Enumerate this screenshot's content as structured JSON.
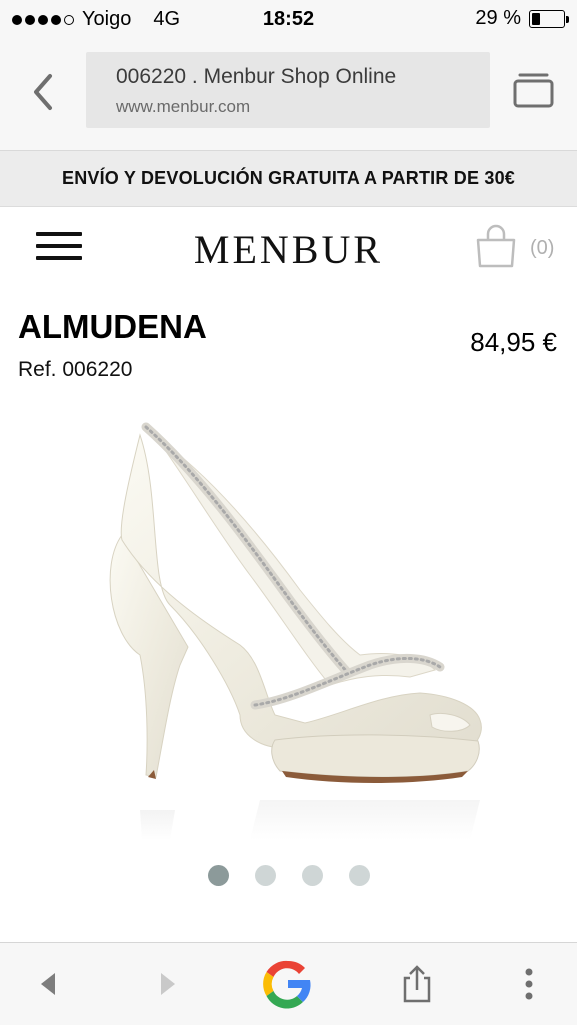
{
  "status": {
    "carrier": "Yoigo",
    "network": "4G",
    "time": "18:52",
    "battery_text": "29 %",
    "battery_level": 0.29
  },
  "browser": {
    "page_title": "006220 . Menbur Shop Online",
    "host": "www.menbur.com",
    "back_icon": "chevron-left-icon",
    "tabs_icon": "tabs-icon"
  },
  "promo": {
    "text": "ENVÍO Y DEVOLUCIÓN GRATUITA A PARTIR DE 30€"
  },
  "site_header": {
    "logo": "MENBUR",
    "cart_count": "(0)",
    "menu_icon": "hamburger-menu-icon",
    "cart_icon": "shopping-bag-icon"
  },
  "product": {
    "name": "ALMUDENA",
    "ref": "Ref. 006220",
    "price": "84,95 €",
    "image_icon": "bridal-peep-toe-pump-image"
  },
  "carousel": {
    "total": 4,
    "active_index": 0
  },
  "toolbar": {
    "icons": [
      "back-arrow-icon",
      "forward-arrow-icon",
      "google-icon",
      "share-icon",
      "more-options-icon"
    ]
  },
  "colors": {
    "accent_gray": "#8c9a9a",
    "inactive_dot": "#cfd6d6",
    "banner_bg": "#ececec"
  }
}
